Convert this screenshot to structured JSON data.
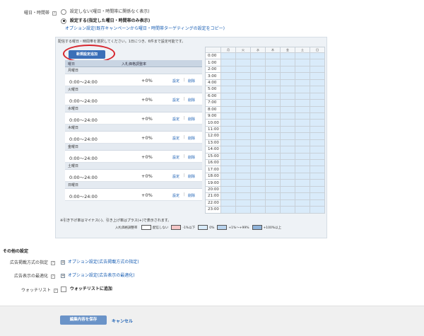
{
  "targeting": {
    "label": "曜日・時間帯",
    "option_unset": "設定しない(曜日・時間帯に関係なく表示)",
    "option_set": "設定する(指定した曜日・時間帯のみ表示)",
    "copy_link": "オプション設定(既存キャンペーンから曜日・時間帯ターゲティングの設定をコピー)",
    "instruction": "配信する曜日・時間帯を選択してください。1日につき、6件まで設定可能です。",
    "new_button": "新規設定追加"
  },
  "schedule": {
    "col_day": "曜日",
    "col_rate": "入札価格調整率",
    "edit_label": "設定",
    "separator": "|",
    "delete_label": "削除",
    "days": [
      {
        "name": "月曜日",
        "time": "0:00〜24:00",
        "rate": "+0%"
      },
      {
        "name": "火曜日",
        "time": "0:00〜24:00",
        "rate": "+0%"
      },
      {
        "name": "水曜日",
        "time": "0:00〜24:00",
        "rate": "+0%"
      },
      {
        "name": "木曜日",
        "time": "0:00〜24:00",
        "rate": "+0%"
      },
      {
        "name": "金曜日",
        "time": "0:00〜24:00",
        "rate": "+0%"
      },
      {
        "name": "土曜日",
        "time": "0:00〜24:00",
        "rate": "+0%"
      },
      {
        "name": "日曜日",
        "time": "0:00〜24:00",
        "rate": "+0%"
      }
    ]
  },
  "grid": {
    "day_headers": [
      "月",
      "火",
      "水",
      "木",
      "金",
      "土",
      "日"
    ],
    "hours": [
      "0:00",
      "1:00",
      "2:00",
      "3:00",
      "4:00",
      "5:00",
      "6:00",
      "7:00",
      "8:00",
      "9:00",
      "10:00",
      "11:00",
      "12:00",
      "13:00",
      "14:00",
      "15:00",
      "16:00",
      "17:00",
      "18:00",
      "19:00",
      "20:00",
      "21:00",
      "22:00",
      "23:00"
    ],
    "cell_color": "#d9ebfa"
  },
  "note": "※引き下げ率はマイナス(-)、引き上げ率はプラス(+)で表示されます。",
  "legend": {
    "title": "入札価格調整率",
    "items": [
      {
        "label": "配信しない",
        "color": "#ffffff"
      },
      {
        "label": "-1%以下",
        "color": "#f4c6c6"
      },
      {
        "label": "0%",
        "color": "#d9ebfa"
      },
      {
        "label": "+1%〜+99%",
        "color": "#b9d3ee"
      },
      {
        "label": "+100%以上",
        "color": "#8fb3da"
      }
    ]
  },
  "other": {
    "title": "その他の設定",
    "ad_delivery_label": "広告掲載方式の指定",
    "ad_delivery_link": "オプション設定(広告掲載方式の指定)",
    "ad_optimize_label": "広告表示の最適化",
    "ad_optimize_link": "オプション設定(広告表示の最適化)",
    "watchlist_label": "ウォッチリスト",
    "watchlist_check": "ウォッチリストに追加"
  },
  "footer": {
    "save": "編集内容を保存",
    "cancel": "キャンセル"
  },
  "colors": {
    "accent": "#3a6fb8",
    "link": "#1a5fb4",
    "highlight_ring": "#d7262d"
  }
}
